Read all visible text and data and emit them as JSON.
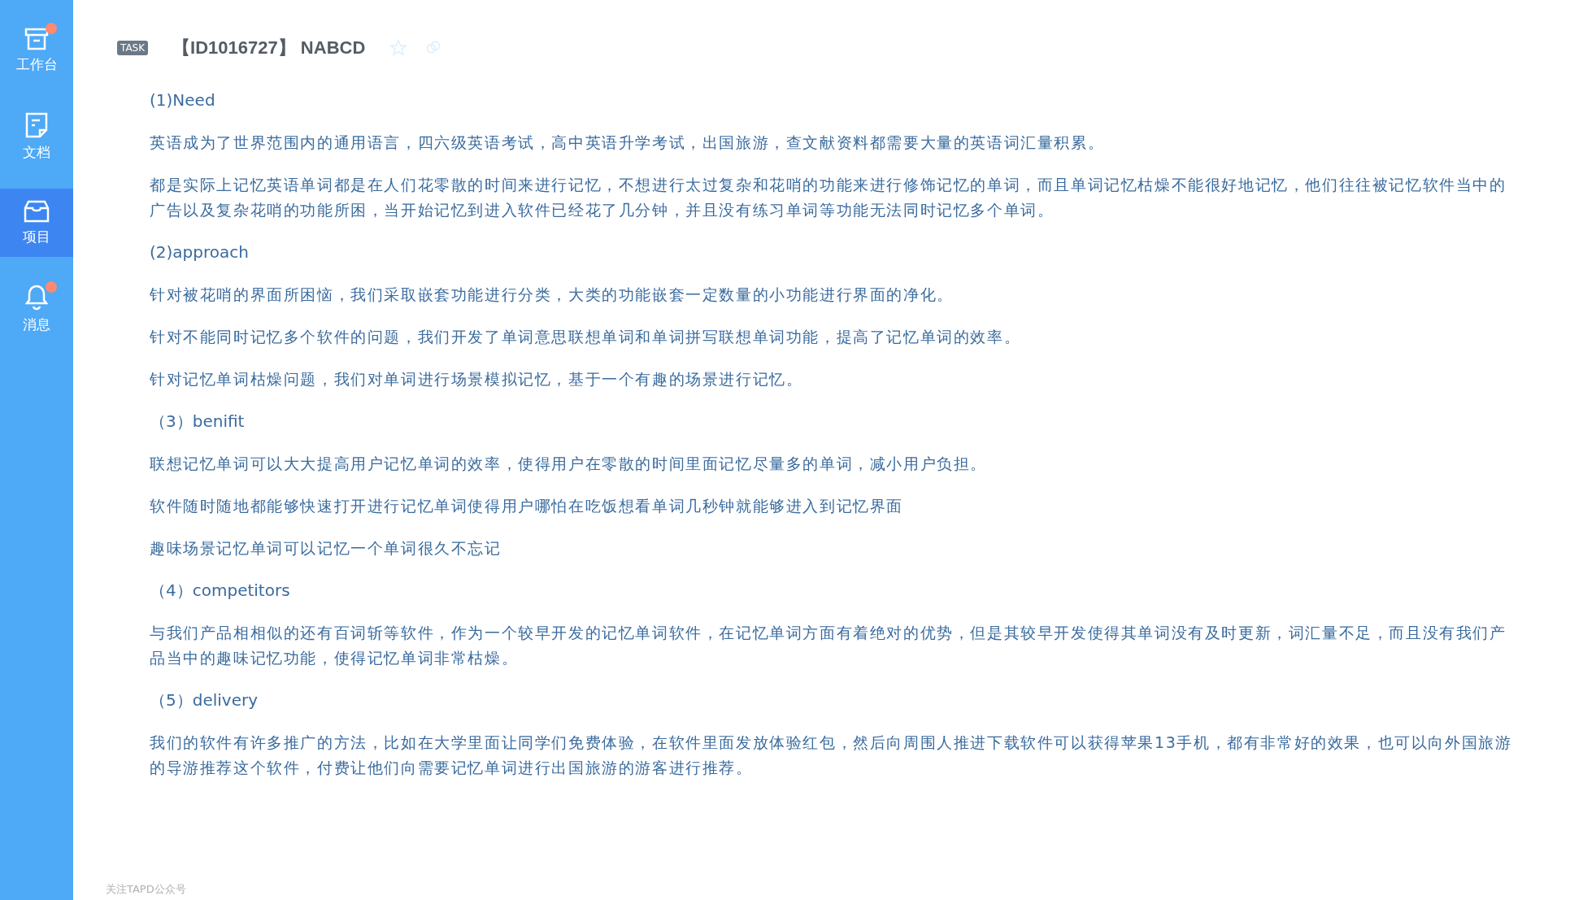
{
  "sidebar": {
    "items": [
      {
        "label": "工作台",
        "kind": "box",
        "selected": false,
        "badge": true
      },
      {
        "label": "文档",
        "kind": "doc",
        "selected": false,
        "badge": false
      },
      {
        "label": "项目",
        "kind": "tray",
        "selected": true,
        "badge": false
      },
      {
        "label": "消息",
        "kind": "bell",
        "selected": false,
        "badge": true
      }
    ]
  },
  "header": {
    "tag": "TASK",
    "title": "【ID1016727】 NABCD"
  },
  "content": [
    {
      "kind": "heading",
      "text": "(1)Need"
    },
    {
      "kind": "paragraph",
      "text": "英语成为了世界范围内的通用语言，四六级英语考试，高中英语升学考试，出国旅游，查文献资料都需要大量的英语词汇量积累。"
    },
    {
      "kind": "paragraph",
      "text": "都是实际上记忆英语单词都是在人们花零散的时间来进行记忆，不想进行太过复杂和花哨的功能来进行修饰记忆的单词，而且单词记忆枯燥不能很好地记忆，他们往往被记忆软件当中的广告以及复杂花哨的功能所困，当开始记忆到进入软件已经花了几分钟，并且没有练习单词等功能无法同时记忆多个单词。"
    },
    {
      "kind": "heading",
      "text": "(2)approach"
    },
    {
      "kind": "paragraph",
      "text": "针对被花哨的界面所困恼，我们采取嵌套功能进行分类，大类的功能嵌套一定数量的小功能进行界面的净化。"
    },
    {
      "kind": "paragraph",
      "text": "针对不能同时记忆多个软件的问题，我们开发了单词意思联想单词和单词拼写联想单词功能，提高了记忆单词的效率。"
    },
    {
      "kind": "paragraph",
      "text": "针对记忆单词枯燥问题，我们对单词进行场景模拟记忆，基于一个有趣的场景进行记忆。"
    },
    {
      "kind": "heading",
      "text": "（3）benifit"
    },
    {
      "kind": "paragraph",
      "text": "联想记忆单词可以大大提高用户记忆单词的效率，使得用户在零散的时间里面记忆尽量多的单词，减小用户负担。"
    },
    {
      "kind": "paragraph",
      "text": "软件随时随地都能够快速打开进行记忆单词使得用户哪怕在吃饭想看单词几秒钟就能够进入到记忆界面"
    },
    {
      "kind": "paragraph",
      "text": "趣味场景记忆单词可以记忆一个单词很久不忘记"
    },
    {
      "kind": "heading",
      "text": "（4）competitors"
    },
    {
      "kind": "paragraph",
      "text": "与我们产品相相似的还有百词斩等软件，作为一个较早开发的记忆单词软件，在记忆单词方面有着绝对的优势，但是其较早开发使得其单词没有及时更新，词汇量不足，而且没有我们产品当中的趣味记忆功能，使得记忆单词非常枯燥。"
    },
    {
      "kind": "heading",
      "text": "（5）delivery"
    },
    {
      "kind": "paragraph",
      "text": "我们的软件有许多推广的方法，比如在大学里面让同学们免费体验，在软件里面发放体验红包，然后向周围人推进下载软件可以获得苹果13手机，都有非常好的效果，也可以向外国旅游的导游推荐这个软件，付费让他们向需要记忆单词进行出国旅游的游客进行推荐。"
    }
  ],
  "footer": {
    "text": "关注TAPD公众号"
  }
}
